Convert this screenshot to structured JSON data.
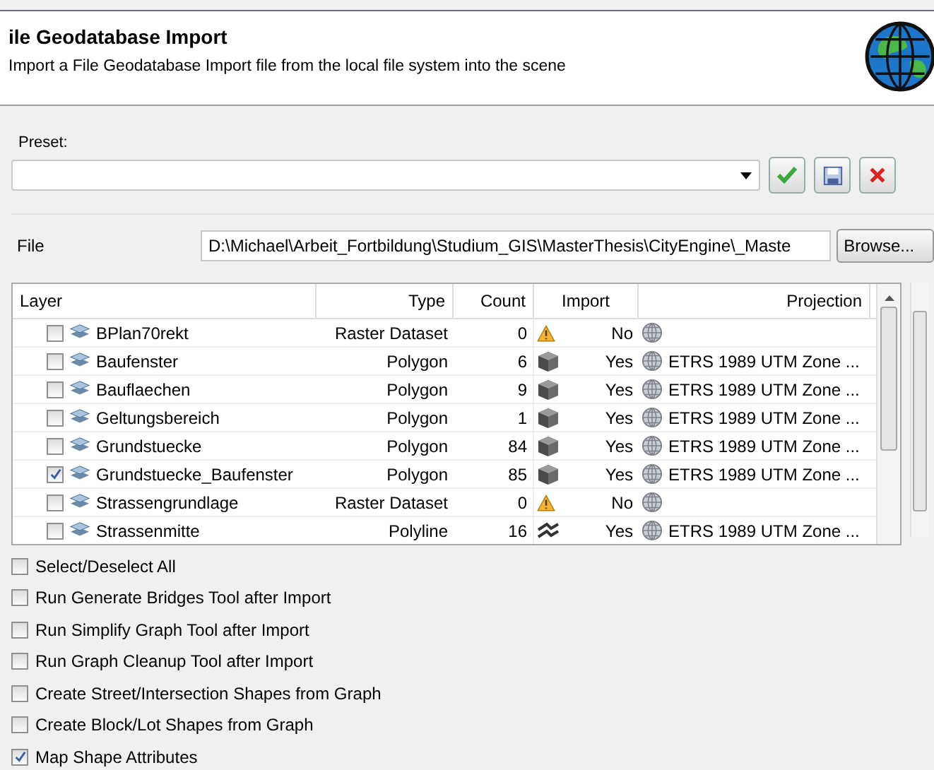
{
  "header": {
    "title": "ile Geodatabase Import",
    "description": "Import a File Geodatabase Import file from the local file system into the scene"
  },
  "preset": {
    "label": "Preset:"
  },
  "file": {
    "label": "File",
    "value": "D:\\Michael\\Arbeit_Fortbildung\\Studium_GIS\\MasterThesis\\CityEngine\\_Maste",
    "browse": "Browse..."
  },
  "table": {
    "columns": [
      "Layer",
      "Type",
      "Count",
      "Import",
      "Projection"
    ],
    "rows": [
      {
        "layer": "BPlan70rekt",
        "type": "Raster Dataset",
        "count": "0",
        "kind": "warning",
        "import": "No",
        "checked": false,
        "projection": ""
      },
      {
        "layer": "Baufenster",
        "type": "Polygon",
        "count": "6",
        "kind": "polygon",
        "import": "Yes",
        "checked": false,
        "projection": "ETRS 1989 UTM Zone ..."
      },
      {
        "layer": "Bauflaechen",
        "type": "Polygon",
        "count": "9",
        "kind": "polygon",
        "import": "Yes",
        "checked": false,
        "projection": "ETRS 1989 UTM Zone ..."
      },
      {
        "layer": "Geltungsbereich",
        "type": "Polygon",
        "count": "1",
        "kind": "polygon",
        "import": "Yes",
        "checked": false,
        "projection": "ETRS 1989 UTM Zone ..."
      },
      {
        "layer": "Grundstuecke",
        "type": "Polygon",
        "count": "84",
        "kind": "polygon",
        "import": "Yes",
        "checked": false,
        "projection": "ETRS 1989 UTM Zone ..."
      },
      {
        "layer": "Grundstuecke_Baufenster",
        "type": "Polygon",
        "count": "85",
        "kind": "polygon",
        "import": "Yes",
        "checked": true,
        "projection": "ETRS 1989 UTM Zone ..."
      },
      {
        "layer": "Strassengrundlage",
        "type": "Raster Dataset",
        "count": "0",
        "kind": "warning",
        "import": "No",
        "checked": false,
        "projection": ""
      },
      {
        "layer": "Strassenmitte",
        "type": "Polyline",
        "count": "16",
        "kind": "polyline",
        "import": "Yes",
        "checked": false,
        "projection": "ETRS 1989 UTM Zone ..."
      }
    ]
  },
  "options": [
    {
      "label": "Select/Deselect All",
      "checked": false
    },
    {
      "label": "Run Generate Bridges Tool after Import",
      "checked": false
    },
    {
      "label": "Run Simplify Graph Tool after Import",
      "checked": false
    },
    {
      "label": "Run Graph Cleanup Tool after Import",
      "checked": false
    },
    {
      "label": "Create Street/Intersection Shapes from Graph",
      "checked": false
    },
    {
      "label": "Create Block/Lot Shapes from Graph",
      "checked": false
    },
    {
      "label": "Map Shape Attributes",
      "checked": true
    }
  ]
}
